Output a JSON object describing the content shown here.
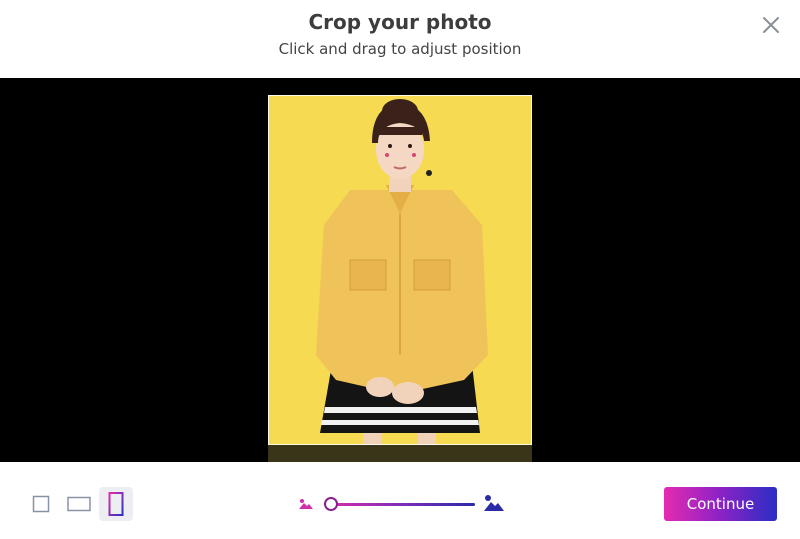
{
  "dialog": {
    "title": "Crop your photo",
    "subtitle": "Click and drag to adjust position"
  },
  "toolbar": {
    "aspect_ratios": [
      {
        "name": "square",
        "active": false
      },
      {
        "name": "landscape",
        "active": false
      },
      {
        "name": "portrait",
        "active": true
      }
    ],
    "zoom_level": 0,
    "continue_label": "Continue"
  },
  "colors": {
    "accent_start": "#e52bb0",
    "accent_end": "#2b2ec4",
    "stage_background": "#000000",
    "photo_background": "#f4d84a"
  }
}
